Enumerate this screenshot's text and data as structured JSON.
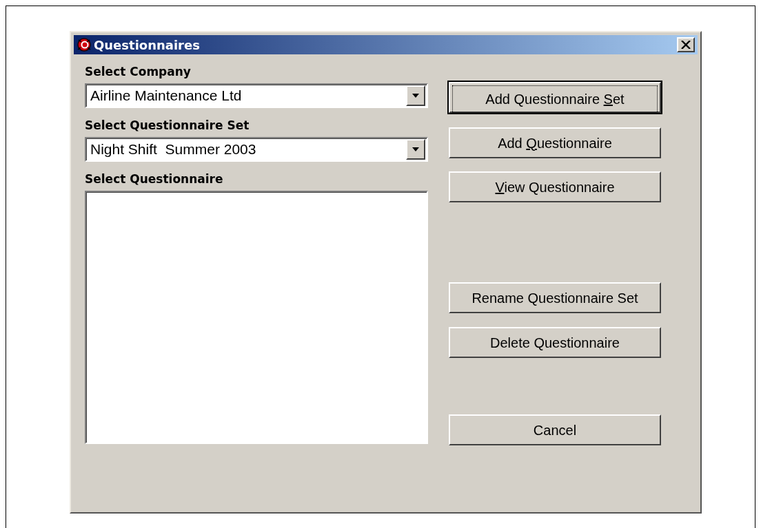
{
  "window": {
    "title": "Questionnaires"
  },
  "fields": [
    {
      "label": "Select Company",
      "kind": "combo",
      "value": "Airline Maintenance Ltd"
    },
    {
      "label": "Select Questionnaire Set",
      "kind": "combo",
      "value": "Night Shift  Summer 2003"
    },
    {
      "label": "Select Questionnaire",
      "kind": "list"
    }
  ],
  "buttons": [
    {
      "label_parts": [
        {
          "text": "Add Questionnaire ",
          "underlined": false
        },
        {
          "text": "S",
          "underlined": true
        },
        {
          "text": "et",
          "underlined": false
        }
      ],
      "default": true
    },
    {
      "label_parts": [
        {
          "text": "Add ",
          "underlined": false
        },
        {
          "text": "Q",
          "underlined": true
        },
        {
          "text": "uestionnaire",
          "underlined": false
        }
      ],
      "default": false
    },
    {
      "label_parts": [
        {
          "text": "V",
          "underlined": true
        },
        {
          "text": "iew Questionnaire",
          "underlined": false
        }
      ],
      "default": false
    },
    {
      "label": "Rename Questionnaire Set",
      "default": false
    },
    {
      "label": "Delete Questionnaire",
      "default": false
    },
    {
      "label": "Cancel",
      "default": false
    }
  ]
}
